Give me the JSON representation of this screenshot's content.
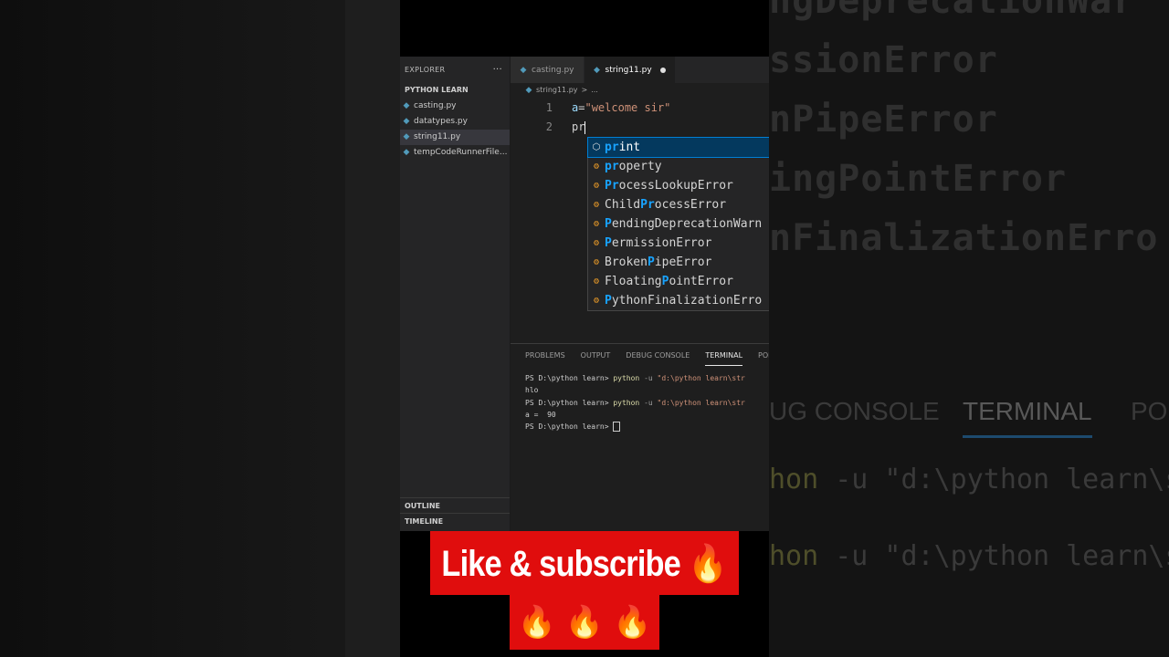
{
  "explorer": {
    "title": "EXPLORER",
    "more": "···",
    "folder": "PYTHON LEARN",
    "files": [
      "casting.py",
      "datatypes.py",
      "string11.py",
      "tempCodeRunnerFile..."
    ],
    "outline": "OUTLINE",
    "timeline": "TIMELINE"
  },
  "tabs": [
    {
      "label": "casting.py"
    },
    {
      "label": "string11.py"
    }
  ],
  "breadcrumb": {
    "file": "string11.py",
    "sep": ">",
    "rest": "..."
  },
  "code": {
    "lines": [
      "1",
      "2"
    ],
    "line1_var": "a",
    "line1_op": "=",
    "line1_str": "\"welcome sir\"",
    "line2": "pr"
  },
  "suggestions": [
    {
      "match": "pr",
      "rest": "int"
    },
    {
      "match": "pr",
      "rest": "operty"
    },
    {
      "match": "Pr",
      "rest": "ocessLookupError"
    },
    {
      "pre": "Child",
      "match": "Pr",
      "rest": "ocessError"
    },
    {
      "match": "P",
      "rest": "endingDeprecationWarn"
    },
    {
      "match": "P",
      "rest": "ermissionError"
    },
    {
      "pre": "Broken",
      "match": "P",
      "rest": "ipeError"
    },
    {
      "pre": "Floating",
      "match": "P",
      "rest": "ointError"
    },
    {
      "match": "P",
      "rest": "ythonFinalizationErro"
    }
  ],
  "panel": {
    "tabs": [
      "PROBLEMS",
      "OUTPUT",
      "DEBUG CONSOLE",
      "TERMINAL",
      "POR"
    ]
  },
  "terminal": {
    "prompt": "PS D:\\python learn>",
    "cmd": "python",
    "flag": "-u",
    "path": "\"d:\\python learn\\str",
    "out1": "hlo",
    "out2": "a =  90"
  },
  "overlay": {
    "line1": "Like & subscribe 🔥",
    "fires": [
      "🔥",
      "🔥",
      "🔥"
    ]
  },
  "backdrop": {
    "right_lines": [
      "ngDeprecationWar",
      "ssionError",
      "nPipeError",
      "ingPointError",
      "nFinalizationErro"
    ],
    "right_tabs": [
      "UG CONSOLE",
      "TERMINAL",
      "POR"
    ],
    "right_cmd_word": "hon",
    "right_cmd_rest": "-u \"d:\\python learn\\str"
  },
  "colors": {
    "accent": "#007fd4",
    "banner": "#e00d0d",
    "match": "#18a3ff"
  }
}
